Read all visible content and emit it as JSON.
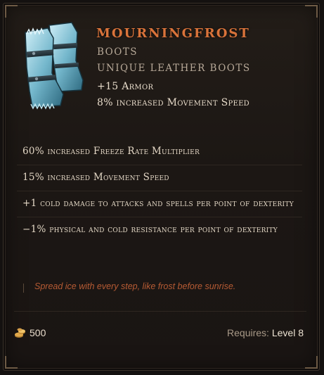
{
  "item": {
    "name": "MOURNINGFROST",
    "slot": "BOOTS",
    "base_type": "UNIQUE LEATHER BOOTS",
    "icon": "frost-fur-boots-icon"
  },
  "implicits": [
    "+15 Armor",
    "8% increased Movement Speed"
  ],
  "affixes": [
    "60% increased Freeze Rate Multiplier",
    "15% increased Movement Speed",
    "+1 cold damage to attacks and spells per point of dexterity",
    "−1% physical and cold resistance per point of dexterity"
  ],
  "flavor_text": "Spread ice with every step, like frost before sunrise.",
  "footer": {
    "gold_icon": "gold-coins-icon",
    "gold_value": "500",
    "requires_label": "Requires:",
    "requires_value": "Level 8"
  },
  "colors": {
    "name": "#d9733a",
    "flavor": "#b75b34",
    "text": "#e2d6c4",
    "subtle": "#b8aa99",
    "background": "#1c1714"
  }
}
